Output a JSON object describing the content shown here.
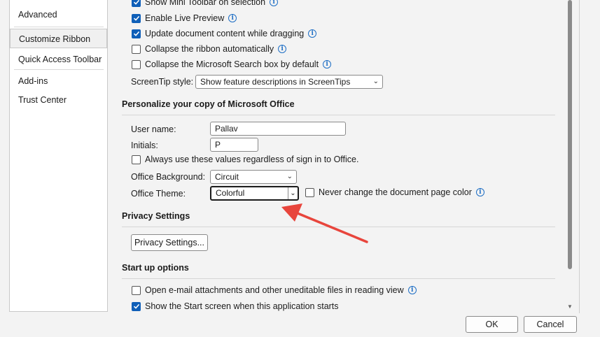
{
  "sidebar": {
    "items": [
      {
        "label": "Advanced"
      },
      {
        "label": "Customize Ribbon"
      },
      {
        "label": "Quick Access Toolbar"
      },
      {
        "label": "Add-ins"
      },
      {
        "label": "Trust Center"
      }
    ],
    "selected": "Customize Ribbon"
  },
  "ui_options": {
    "mini_toolbar": {
      "label": "Show Mini Toolbar on selection",
      "checked": true
    },
    "live_preview": {
      "label": "Enable Live Preview",
      "checked": true
    },
    "update_dragging": {
      "label": "Update document content while dragging",
      "checked": true
    },
    "collapse_ribbon": {
      "label": "Collapse the ribbon automatically",
      "checked": false
    },
    "collapse_search": {
      "label": "Collapse the Microsoft Search box by default",
      "checked": false
    },
    "screentip_label": "ScreenTip style:",
    "screentip_value": "Show feature descriptions in ScreenTips"
  },
  "personalize": {
    "title": "Personalize your copy of Microsoft Office",
    "username_label": "User name:",
    "username_value": "Pallav",
    "initials_label": "Initials:",
    "initials_value": "P",
    "always_use": {
      "label": "Always use these values regardless of sign in to Office.",
      "checked": false
    },
    "background_label": "Office Background:",
    "background_value": "Circuit",
    "theme_label": "Office Theme:",
    "theme_value": "Colorful",
    "never_change": {
      "label": "Never change the document page color",
      "checked": false
    }
  },
  "privacy": {
    "title": "Privacy Settings",
    "button": "Privacy Settings..."
  },
  "startup": {
    "title": "Start up options",
    "open_email": {
      "label": "Open e-mail attachments and other uneditable files in reading view",
      "checked": false
    },
    "show_start": {
      "label": "Show the Start screen when this application starts",
      "checked": true
    }
  },
  "footer": {
    "ok": "OK",
    "cancel": "Cancel"
  },
  "colors": {
    "accent": "#0f5fb8",
    "arrow": "#e8453c"
  }
}
